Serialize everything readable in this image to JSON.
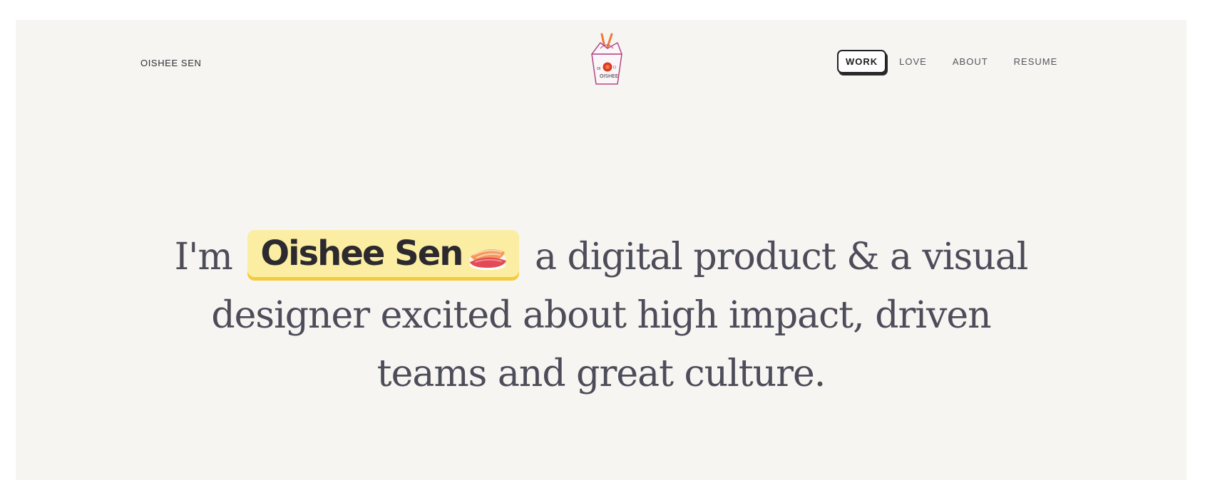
{
  "header": {
    "site_name": "OISHEE SEN",
    "logo_icon": "takeout-box-logo-icon",
    "logo_text": "OISHEE"
  },
  "nav": {
    "items": [
      {
        "label": "WORK",
        "active": true
      },
      {
        "label": "LOVE",
        "active": false
      },
      {
        "label": "ABOUT",
        "active": false
      },
      {
        "label": "RESUME",
        "active": false
      }
    ]
  },
  "hero": {
    "prefix": "I'm",
    "name": "Oishee Sen",
    "name_icon": "sushi-icon",
    "line1_suffix": "a digital product & a visual",
    "line2": "designer excited about high impact, driven",
    "line3": "teams and great culture."
  },
  "colors": {
    "page_bg": "#f6f5f2",
    "text": "#4d4c59",
    "highlight": "#fbeea3",
    "highlight_shadow": "#f5cb3e"
  }
}
